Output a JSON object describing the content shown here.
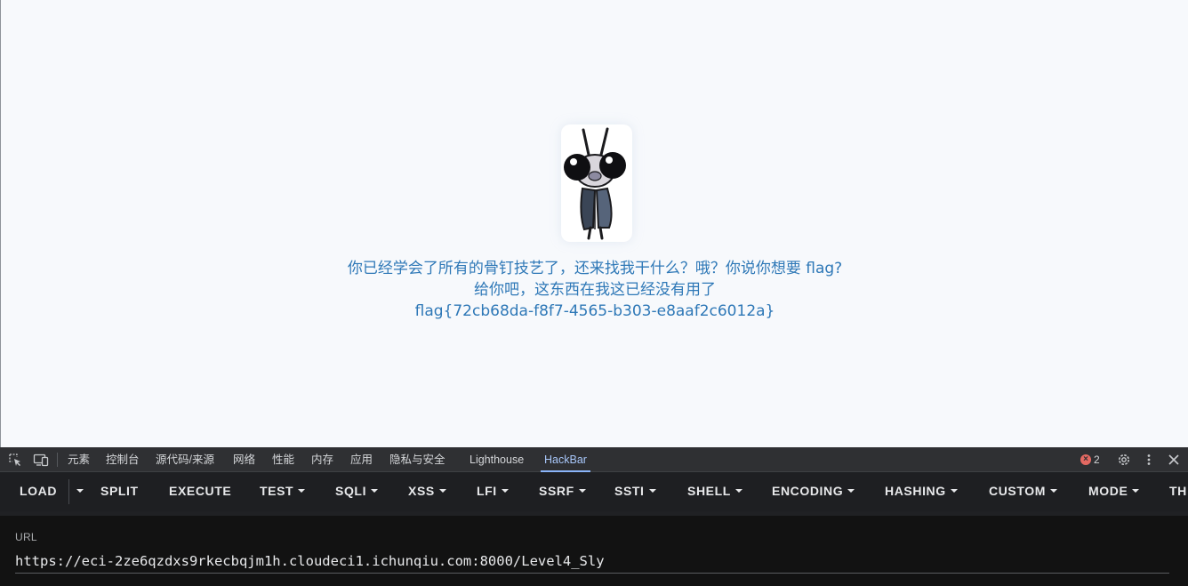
{
  "page": {
    "message_line1": "你已经学会了所有的骨钉技艺了，还来找我干什么？哦？你说你想要 flag?",
    "message_line2": "给你吧，这东西在我这已经没有用了",
    "flag_text": "flag{72cb68da-f8f7-4565-b303-e8aaf2c6012a}",
    "text_color": "#2e78b7"
  },
  "devtools": {
    "tabs": [
      "元素",
      "控制台",
      "源代码/来源",
      "网络",
      "性能",
      "内存",
      "应用",
      "隐私与安全",
      "Lighthouse",
      "HackBar"
    ],
    "active_tab": "HackBar",
    "error_count": "2",
    "icons": [
      "inspect-element-icon",
      "device-toolbar-icon",
      "error-icon",
      "settings-gear-icon",
      "more-vertical-icon",
      "close-icon"
    ]
  },
  "hackbar": {
    "buttons": {
      "load": "LOAD",
      "split": "SPLIT",
      "execute": "EXECUTE",
      "test": "TEST",
      "sqli": "SQLI",
      "xss": "XSS",
      "lfi": "LFI",
      "ssrf": "SSRF",
      "ssti": "SSTI",
      "shell": "SHELL",
      "encoding": "ENCODING",
      "hashing": "HASHING",
      "custom": "CUSTOM",
      "mode": "MODE",
      "theme": "TH"
    },
    "url_label": "URL",
    "url_value": "https://eci-2ze6qzdxs9rkecbqjm1h.cloudeci1.ichunqiu.com:8000/Level4_Sly"
  }
}
